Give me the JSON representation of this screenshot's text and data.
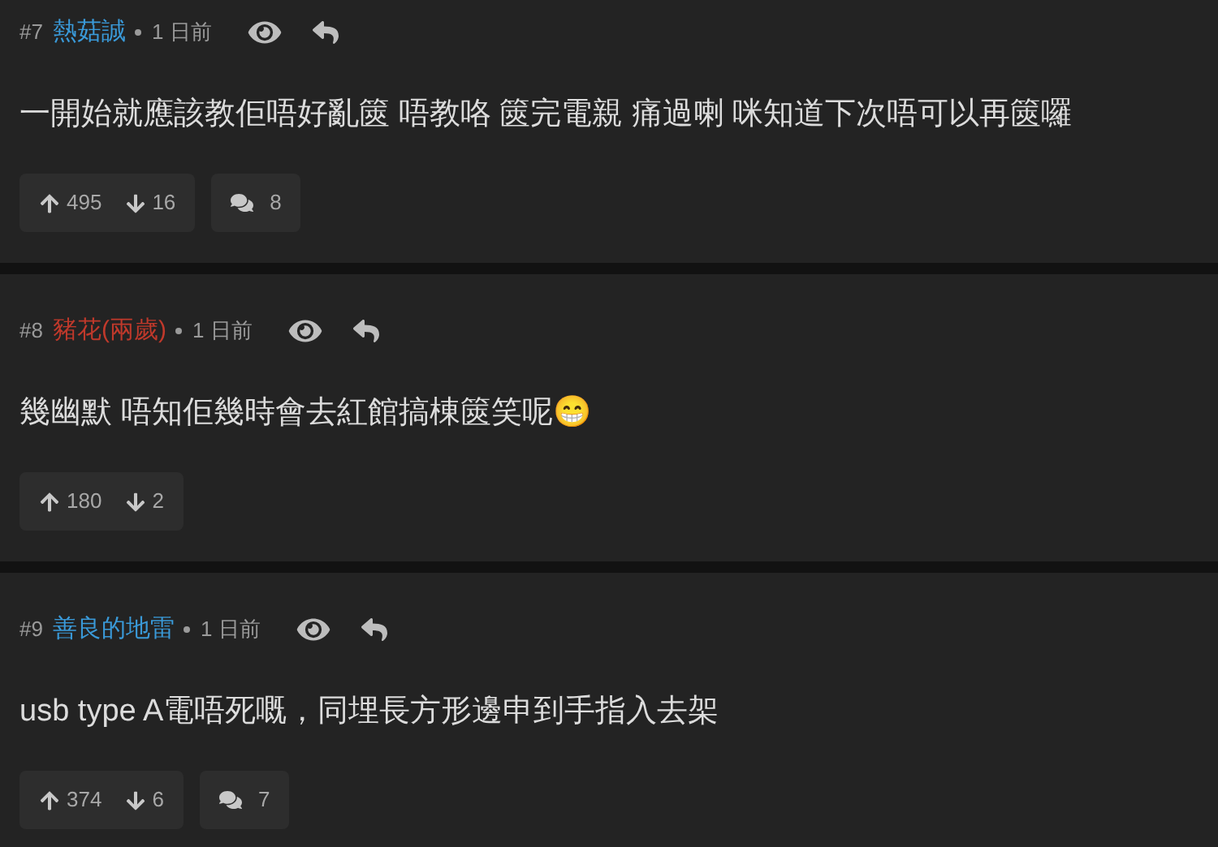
{
  "posts": [
    {
      "number": "#7",
      "username": "熱菇誠",
      "color": "#3a9ad9",
      "time": "1 日前",
      "text": "一開始就應該教佢唔好亂篋 唔教咯 篋完電親 痛過喇 咪知道下次唔可以再篋囉",
      "upvotes": "495",
      "downvotes": "16",
      "comments": "8"
    },
    {
      "number": "#8",
      "username": "豬花(兩歲)",
      "color": "#c0392b",
      "time": "1 日前",
      "text": "幾幽默 唔知佢幾時會去紅館搞棟篋笑呢😁",
      "upvotes": "180",
      "downvotes": "2"
    },
    {
      "number": "#9",
      "username": "善良的地雷",
      "color": "#3a9ad9",
      "time": "1 日前",
      "text": "usb type A電唔死嘅，同埋長方形邊申到手指入去架",
      "upvotes": "374",
      "downvotes": "6",
      "comments": "7"
    }
  ]
}
